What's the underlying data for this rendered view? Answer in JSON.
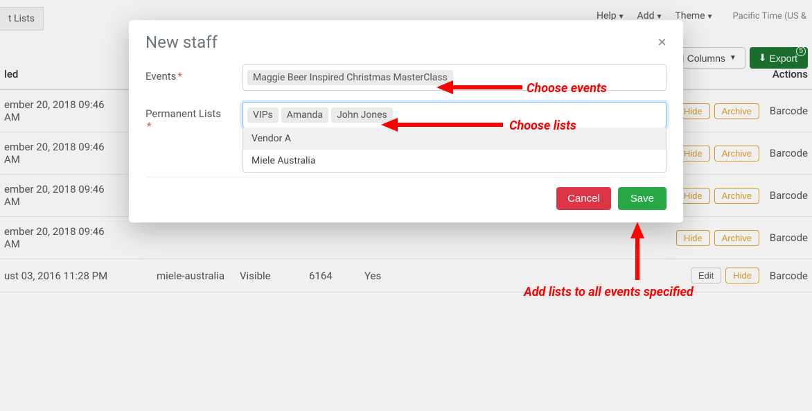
{
  "topbar": {
    "help": "Help",
    "add": "Add",
    "theme": "Theme",
    "timezone": "Pacific Time (US &"
  },
  "tab_lists": "t Lists",
  "toolbar": {
    "columns": "Columns",
    "export": "Export",
    "export_count": "5"
  },
  "table": {
    "headers": {
      "modified": "led",
      "actions": "Actions"
    },
    "rows": [
      {
        "date": "ember 20, 2018 09:46 AM",
        "slug": "",
        "visibility": "",
        "count": "",
        "flag": "",
        "actions": [
          "Hide",
          "Archive"
        ],
        "barcode": "Barcode"
      },
      {
        "date": "ember 20, 2018 09:46 AM",
        "slug": "",
        "visibility": "",
        "count": "",
        "flag": "",
        "actions": [
          "Hide",
          "Archive"
        ],
        "barcode": "Barcode"
      },
      {
        "date": "ember 20, 2018 09:46 AM",
        "slug": "",
        "visibility": "",
        "count": "",
        "flag": "",
        "actions": [
          "Hide",
          "Archive"
        ],
        "barcode": "Barcode"
      },
      {
        "date": "ember 20, 2018 09:46 AM",
        "slug": "",
        "visibility": "",
        "count": "",
        "flag": "",
        "actions": [
          "Hide",
          "Archive"
        ],
        "barcode": "Barcode"
      },
      {
        "date": "ust 03, 2016 11:28 PM",
        "slug": "miele-australia",
        "visibility": "Visible",
        "count": "6164",
        "flag": "Yes",
        "actions": [
          "Edit",
          "Hide"
        ],
        "barcode": "Barcode"
      }
    ]
  },
  "modal": {
    "title": "New staff",
    "events_label": "Events",
    "events_tags": [
      "Maggie Beer Inspired Christmas MasterClass"
    ],
    "lists_label": "Permanent Lists",
    "lists_tags": [
      "VIPs",
      "Amanda",
      "John Jones"
    ],
    "dropdown_options": [
      "Vendor A",
      "Miele Australia"
    ],
    "cancel": "Cancel",
    "save": "Save"
  },
  "annotations": {
    "choose_events": "Choose events",
    "choose_lists": "Choose lists",
    "add_lists": "Add lists to all events specified"
  }
}
